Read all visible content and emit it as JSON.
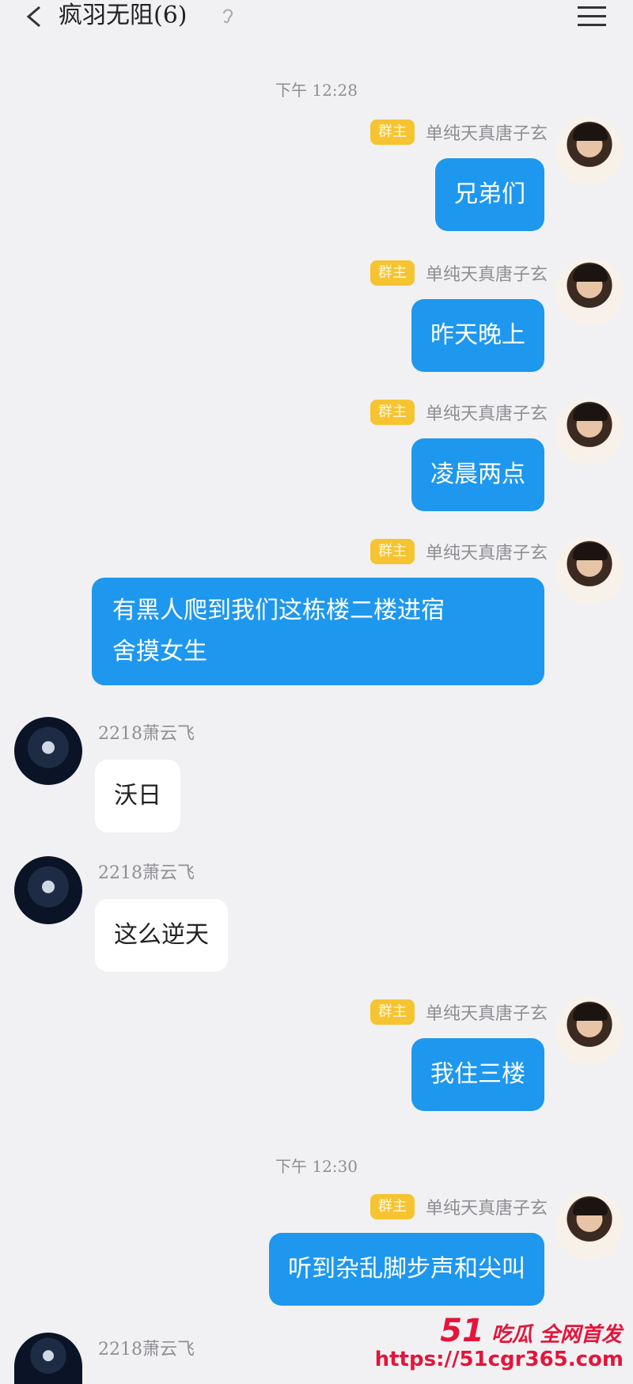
{
  "header": {
    "title": "疯羽无阻(6)",
    "back_icon": "chevron-left-icon",
    "ear_icon": "ear-icon",
    "menu_icon": "hamburger-menu-icon"
  },
  "colors": {
    "self_bubble": "#1e97ee",
    "other_bubble": "#ffffff",
    "badge": "#f6c431",
    "background": "#f1f1f3",
    "watermark": "#e5143a"
  },
  "timestamps": [
    "下午 12:28",
    "下午 12:30"
  ],
  "owner_badge": "群主",
  "self_name": "单纯天真唐子玄",
  "other_name": "2218萧云飞",
  "messages": [
    {
      "text": "兄弟们"
    },
    {
      "text": "昨天晚上"
    },
    {
      "text": "凌晨两点"
    },
    {
      "line1": "有黑人爬到我们这栋楼二楼进宿",
      "line2": "舍摸女生"
    },
    {
      "text": "沃日"
    },
    {
      "text": "这么逆天"
    },
    {
      "text": "我住三楼"
    },
    {
      "text": "听到杂乱脚步声和尖叫"
    }
  ],
  "watermark": {
    "number": "51",
    "brand": "吃瓜 全网首发",
    "url": "https://51cgr365.com"
  }
}
